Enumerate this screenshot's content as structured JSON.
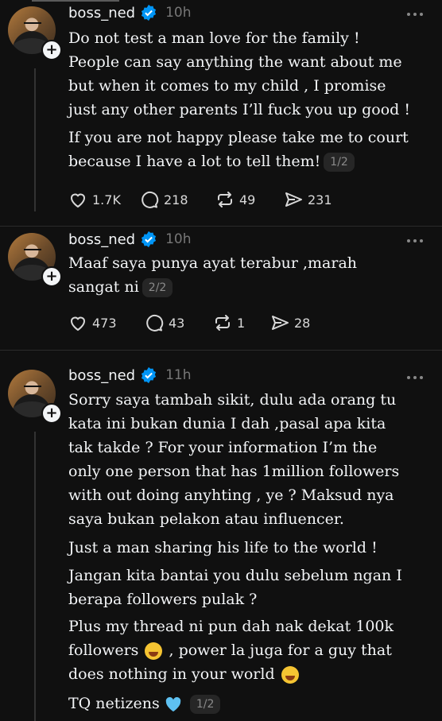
{
  "posts": [
    {
      "username": "boss_ned",
      "time": "10h",
      "paragraphs": [
        "Do not test a man love for the family !\nPeople can say anything the want about me\nbut when it comes to my child , I promise\njust any other parents I’ll fuck you up good !",
        "If you are not happy please take me to court\nbecause I have a lot to tell them!"
      ],
      "pager": "1/2",
      "stats": {
        "likes": "1.7K",
        "replies": "218",
        "reposts": "49",
        "shares": "231"
      }
    },
    {
      "username": "boss_ned",
      "time": "10h",
      "paragraphs": [
        "Maaf saya punya ayat terabur ,marah\nsangat ni"
      ],
      "pager": "2/2",
      "stats": {
        "likes": "473",
        "replies": "43",
        "reposts": "1",
        "shares": "28"
      }
    },
    {
      "username": "boss_ned",
      "time": "11h",
      "paragraphs": [
        "Sorry saya tambah sikit, dulu ada orang tu\nkata ini bukan dunia I dah ,pasal apa kita\ntak takde ? For your information I’m the\nonly one person that  has 1million followers\nwith out doing anyhting , ye ?  Maksud nya\nsaya bukan pelakon atau influencer.",
        "Just a man sharing his life to the world !",
        "Jangan kita bantai you dulu sebelum ngan I\nberapa followers pulak ?",
        "Plus my thread ni pun dah nak dekat 100k\nfollowers",
        ", power la juga for a guy that",
        "does nothing in your world",
        "TQ netizens"
      ],
      "pager": "1/2"
    }
  ],
  "colors": {
    "background": "#101010",
    "text": "#f3f5f7",
    "muted": "#777777",
    "verified": "#0095f6"
  },
  "icons": [
    "heart-icon",
    "reply-icon",
    "repost-icon",
    "share-icon",
    "verified-badge-icon",
    "more-icon",
    "follow-plus-icon",
    "rofl-emoji-icon",
    "blue-heart-emoji-icon"
  ]
}
